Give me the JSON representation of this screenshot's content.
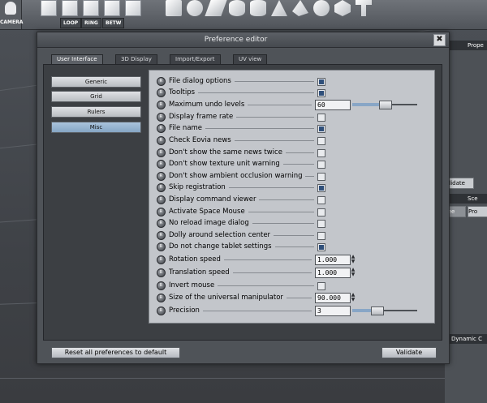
{
  "app": {
    "camera_label": "CAMERA",
    "mode_buttons": [
      "LOOP",
      "RING",
      "BETW"
    ],
    "right_panel": {
      "header_1": "Prope",
      "validate_label": "alidate",
      "header_2": "Sce",
      "tab_1": "ree",
      "tab_2": "Pro",
      "header_3": "Dynamic C"
    }
  },
  "dialog": {
    "title": "Preference editor",
    "close_glyph": "✖",
    "tabs": [
      "User Interface",
      "3D Display",
      "Import/Export",
      "UV view"
    ],
    "active_tab": "User Interface",
    "categories": [
      "Generic",
      "Grid",
      "Rulers",
      "Misc"
    ],
    "active_category": "Misc",
    "reset_label": "Reset all preferences to default",
    "validate_label": "Validate",
    "prefs": [
      {
        "label": "File dialog options",
        "type": "check",
        "checked": true
      },
      {
        "label": "Tooltips",
        "type": "check",
        "checked": true
      },
      {
        "label": "Maximum undo levels",
        "type": "slider",
        "value": "60",
        "level": 0.5
      },
      {
        "label": "Display frame rate",
        "type": "check",
        "checked": false
      },
      {
        "label": "File name",
        "type": "check",
        "checked": true
      },
      {
        "label": "Check Eovia news",
        "type": "check",
        "checked": false
      },
      {
        "label": "Don't show the same news twice",
        "type": "check",
        "checked": false
      },
      {
        "label": "Don't show texture unit warning",
        "type": "check",
        "checked": false
      },
      {
        "label": "Don't show ambient occlusion warning",
        "type": "check",
        "checked": false
      },
      {
        "label": "Skip registration",
        "type": "check",
        "checked": true
      },
      {
        "label": "Display command viewer",
        "type": "check",
        "checked": false
      },
      {
        "label": "Activate Space Mouse",
        "type": "check",
        "checked": false
      },
      {
        "label": "No reload image dialog",
        "type": "check",
        "checked": false
      },
      {
        "label": "Dolly around selection center",
        "type": "check",
        "checked": false
      },
      {
        "label": "Do not change tablet settings",
        "type": "check",
        "checked": true
      },
      {
        "label": "Rotation speed",
        "type": "spin",
        "value": "1.000"
      },
      {
        "label": "Translation speed",
        "type": "spin",
        "value": "1.000"
      },
      {
        "label": "Invert mouse",
        "type": "check",
        "checked": false
      },
      {
        "label": "Size of the universal manipulator",
        "type": "spin",
        "value": "90.000"
      },
      {
        "label": "Precision",
        "type": "slider",
        "value": "3",
        "level": 0.38
      }
    ]
  }
}
